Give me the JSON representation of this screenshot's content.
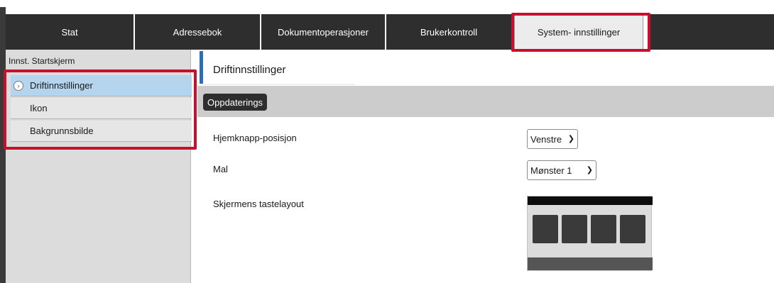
{
  "tabs": [
    {
      "label": "Stat"
    },
    {
      "label": "Adressebok"
    },
    {
      "label": "Dokumentoperasjoner"
    },
    {
      "label": "Brukerkontroll"
    },
    {
      "label": "System- innstillinger",
      "active": true
    }
  ],
  "sidebar": {
    "header": "Innst. Startskjerm",
    "items": [
      {
        "label": "Driftinnstillinger",
        "active": true,
        "icon": "circle-chevron-right-icon"
      },
      {
        "label": "Ikon"
      },
      {
        "label": "Bakgrunnsbilde"
      }
    ]
  },
  "main": {
    "title": "Driftinnstillinger",
    "update_button": "Oppdaterings",
    "fields": [
      {
        "label": "Hjemknapp-posisjon",
        "value": "Venstre"
      },
      {
        "label": "Mal",
        "value": "Mønster 1"
      },
      {
        "label": "Skjermens tastelayout"
      }
    ]
  },
  "colors": {
    "highlight": "#c8102e",
    "tab_dark": "#2e2e2e",
    "accent": "#2d6fb6",
    "sidebar_active": "#b5d5ee"
  }
}
